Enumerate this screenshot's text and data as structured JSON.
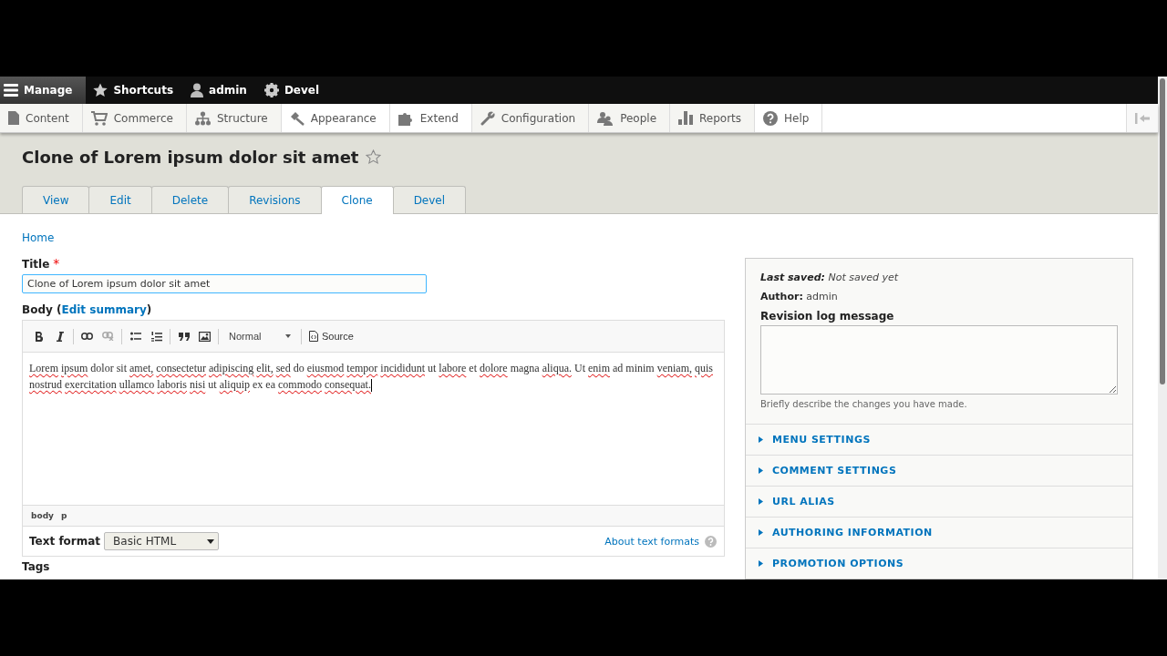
{
  "toolbar": {
    "items": [
      {
        "label": "Manage",
        "kind": "menu",
        "selected": true
      },
      {
        "label": "Shortcuts",
        "kind": "star",
        "selected": false
      },
      {
        "label": "admin",
        "kind": "user",
        "selected": false
      },
      {
        "label": "Devel",
        "kind": "gear",
        "selected": false
      }
    ]
  },
  "tray": {
    "items": [
      {
        "label": "Content",
        "kind": "page",
        "highlighted": false
      },
      {
        "label": "Commerce",
        "kind": "cart",
        "highlighted": false
      },
      {
        "label": "Structure",
        "kind": "sitemap",
        "highlighted": false
      },
      {
        "label": "Appearance",
        "kind": "brush",
        "highlighted": true
      },
      {
        "label": "Extend",
        "kind": "puzzle",
        "highlighted": true
      },
      {
        "label": "Configuration",
        "kind": "wrench",
        "highlighted": false
      },
      {
        "label": "People",
        "kind": "people",
        "highlighted": false
      },
      {
        "label": "Reports",
        "kind": "bars",
        "highlighted": false
      },
      {
        "label": "Help",
        "kind": "help",
        "highlighted": true
      }
    ]
  },
  "page_title": "Clone of Lorem ipsum dolor sit amet",
  "tabs": [
    {
      "label": "View",
      "selected": false
    },
    {
      "label": "Edit",
      "selected": false
    },
    {
      "label": "Delete",
      "selected": false
    },
    {
      "label": "Revisions",
      "selected": false
    },
    {
      "label": "Clone",
      "selected": true
    },
    {
      "label": "Devel",
      "selected": false
    }
  ],
  "breadcrumb": "Home",
  "title_field": {
    "label": "Title",
    "required_marker": "*",
    "value": "Clone of Lorem ipsum dolor sit amet"
  },
  "body": {
    "label": "Body (",
    "link": "Edit summary",
    "label_end": ")",
    "format_style": "Normal",
    "source_label": "Source",
    "text": [
      {
        "text": "Lorem",
        "misspelled": true
      },
      {
        "text": "ipsum",
        "misspelled": true
      },
      {
        "text": "dolor",
        "misspelled": false
      },
      {
        "text": "sit",
        "misspelled": false
      },
      {
        "text": "amet,",
        "misspelled": true
      },
      {
        "text": "consectetur",
        "misspelled": true
      },
      {
        "text": "adipiscing",
        "misspelled": true
      },
      {
        "text": "elit,",
        "misspelled": true
      },
      {
        "text": "sed",
        "misspelled": true
      },
      {
        "text": "do",
        "misspelled": false
      },
      {
        "text": "eiusmod",
        "misspelled": true
      },
      {
        "text": "tempor",
        "misspelled": true
      },
      {
        "text": "incididunt",
        "misspelled": true
      },
      {
        "text": "ut",
        "misspelled": false
      },
      {
        "text": "labore",
        "misspelled": true
      },
      {
        "text": "et",
        "misspelled": false
      },
      {
        "text": "dolore",
        "misspelled": true
      },
      {
        "text": "magna",
        "misspelled": false
      },
      {
        "text": "aliqua.",
        "misspelled": true
      },
      {
        "text": "Ut",
        "misspelled": false
      },
      {
        "text": "enim",
        "misspelled": true
      },
      {
        "text": "ad",
        "misspelled": false
      },
      {
        "text": "minim",
        "misspelled": false
      },
      {
        "text": "veniam,",
        "misspelled": true
      },
      {
        "text": "quis",
        "misspelled": true
      },
      {
        "text": "nostrud",
        "misspelled": true
      },
      {
        "text": "exercitation",
        "misspelled": true
      },
      {
        "text": "ullamco",
        "misspelled": true
      },
      {
        "text": "laboris",
        "misspelled": true
      },
      {
        "text": "nisi",
        "misspelled": true
      },
      {
        "text": "ut",
        "misspelled": false
      },
      {
        "text": "aliquip",
        "misspelled": true
      },
      {
        "text": "ex",
        "misspelled": false
      },
      {
        "text": "ea",
        "misspelled": false
      },
      {
        "text": "commodo",
        "misspelled": true
      },
      {
        "text": "consequat.",
        "misspelled": true
      }
    ],
    "path": [
      "body",
      "p"
    ],
    "text_format_label": "Text format",
    "text_format_value": "Basic HTML",
    "about_link": "About text formats"
  },
  "tags_label": "Tags",
  "sidebar": {
    "last_saved_label": "Last saved:",
    "last_saved_value": "Not saved yet",
    "author_label": "Author:",
    "author_value": "admin",
    "revision_label": "Revision log message",
    "revision_help": "Briefly describe the changes you have made.",
    "sections": [
      {
        "label": "MENU SETTINGS",
        "expanded": false
      },
      {
        "label": "COMMENT SETTINGS",
        "expanded": false
      },
      {
        "label": "URL ALIAS",
        "expanded": false
      },
      {
        "label": "AUTHORING INFORMATION",
        "expanded": false
      },
      {
        "label": "PROMOTION OPTIONS",
        "expanded": false
      }
    ]
  }
}
